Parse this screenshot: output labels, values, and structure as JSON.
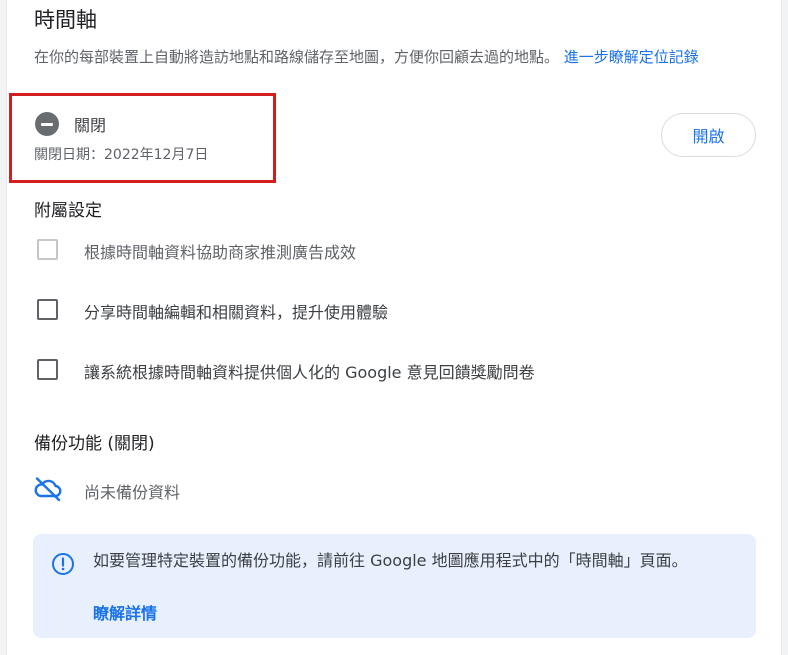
{
  "timeline": {
    "title": "時間軸",
    "description": "在你的每部裝置上自動將造訪地點和路線儲存至地圖，方便你回顧去過的地點。",
    "learn_more_link": "進一步瞭解定位記錄",
    "status_label": "關閉",
    "status_date": "關閉日期：2022年12月7日",
    "enable_button": "開啟"
  },
  "accessory": {
    "heading": "附屬設定",
    "options": [
      {
        "label": "根據時間軸資料協助商家推測廣告成效",
        "checked": false,
        "disabled": true
      },
      {
        "label": "分享時間軸編輯和相關資料，提升使用體驗",
        "checked": false,
        "disabled": false
      },
      {
        "label": "讓系統根據時間軸資料提供個人化的 Google 意見回饋獎勵問卷",
        "checked": false,
        "disabled": false
      }
    ]
  },
  "backup": {
    "heading": "備份功能 (關閉)",
    "status_text": "尚未備份資料",
    "icon": "cloud-off-icon"
  },
  "info": {
    "text": "如要管理特定裝置的備份功能，請前往 Google 地圖應用程式中的「時間軸」頁面。",
    "link": "瞭解詳情",
    "icon": "info-icon"
  },
  "colors": {
    "accent": "#1a73e8",
    "highlight_border": "#d11f1f",
    "info_bg": "#e8f0fe"
  }
}
